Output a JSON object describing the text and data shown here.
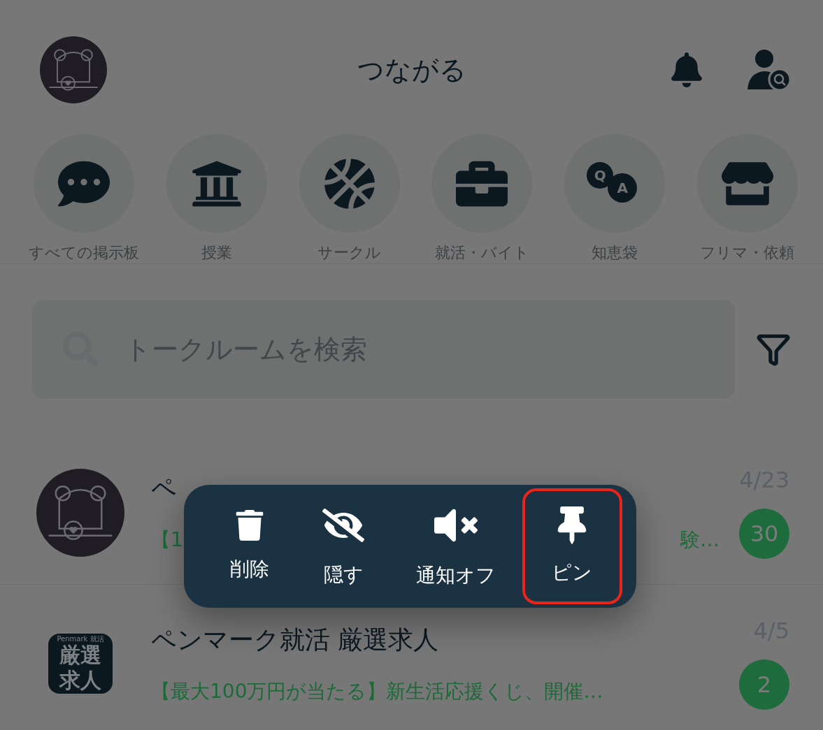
{
  "header": {
    "title": "つながる"
  },
  "categories": [
    {
      "label": "すべての掲示板"
    },
    {
      "label": "授業"
    },
    {
      "label": "サークル"
    },
    {
      "label": "就活・バイト"
    },
    {
      "label": "知恵袋",
      "icon_letters": [
        "Q",
        "A"
      ]
    },
    {
      "label": "フリマ・依頼"
    }
  ],
  "search": {
    "placeholder": "トークルームを検索"
  },
  "rooms": [
    {
      "kind": "avatar",
      "title": "ペ",
      "preview": [
        "【1",
        "験…"
      ],
      "date": "4/23",
      "unread": "30"
    },
    {
      "kind": "logo",
      "logo": {
        "brand": "Penmark 就活",
        "lines": [
          "厳選",
          "求人"
        ]
      },
      "title": "ペンマーク就活 厳選求人",
      "preview": [
        "【最大100万円が当たる】新生活応援くじ、開催…"
      ],
      "date": "4/5",
      "unread": "2"
    }
  ],
  "context_menu": {
    "items": [
      {
        "label": "削除",
        "selected": false
      },
      {
        "label": "隠す",
        "selected": false
      },
      {
        "label": "通知オフ",
        "selected": false
      },
      {
        "label": "ピン",
        "selected": true
      }
    ]
  }
}
